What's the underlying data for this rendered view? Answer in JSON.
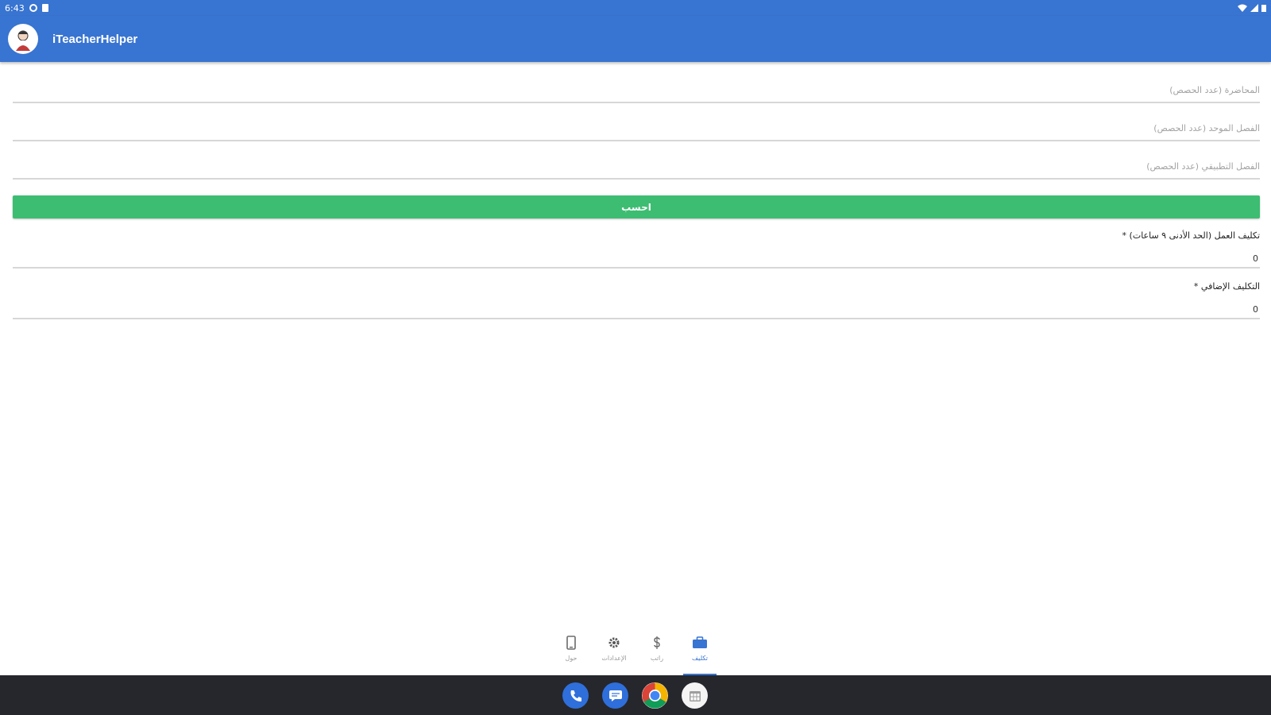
{
  "status_bar": {
    "time": "6:43"
  },
  "app": {
    "title": "iTeacherHelper"
  },
  "form": {
    "fields": [
      {
        "placeholder": "المحاضرة (عدد الحصص)"
      },
      {
        "placeholder": "الفصل الموحد (عدد الحصص)"
      },
      {
        "placeholder": "الفصل التطبيقي (عدد الحصص)"
      }
    ],
    "calculate_label": "احسب"
  },
  "results": [
    {
      "label": "تكليف العمل (الحد الأدنى ٩ ساعات) *",
      "value": "0"
    },
    {
      "label": "التكليف الإضافي *",
      "value": "0"
    }
  ],
  "bottom_nav": {
    "items": [
      {
        "label": "حول",
        "icon": "phone-device-icon"
      },
      {
        "label": "الإعدادات",
        "icon": "gear-icon"
      },
      {
        "label": "راتب",
        "icon": "dollar-icon"
      },
      {
        "label": "تكليف",
        "icon": "briefcase-icon"
      }
    ],
    "active_index": 3
  },
  "dock": {
    "apps": [
      {
        "icon": "phone-icon"
      },
      {
        "icon": "messages-icon"
      },
      {
        "icon": "chrome-icon"
      },
      {
        "icon": "calendar-icon"
      }
    ]
  },
  "colors": {
    "primary": "#3874d1",
    "accent_button": "#3dbd72",
    "system_bar": "#25272c"
  }
}
